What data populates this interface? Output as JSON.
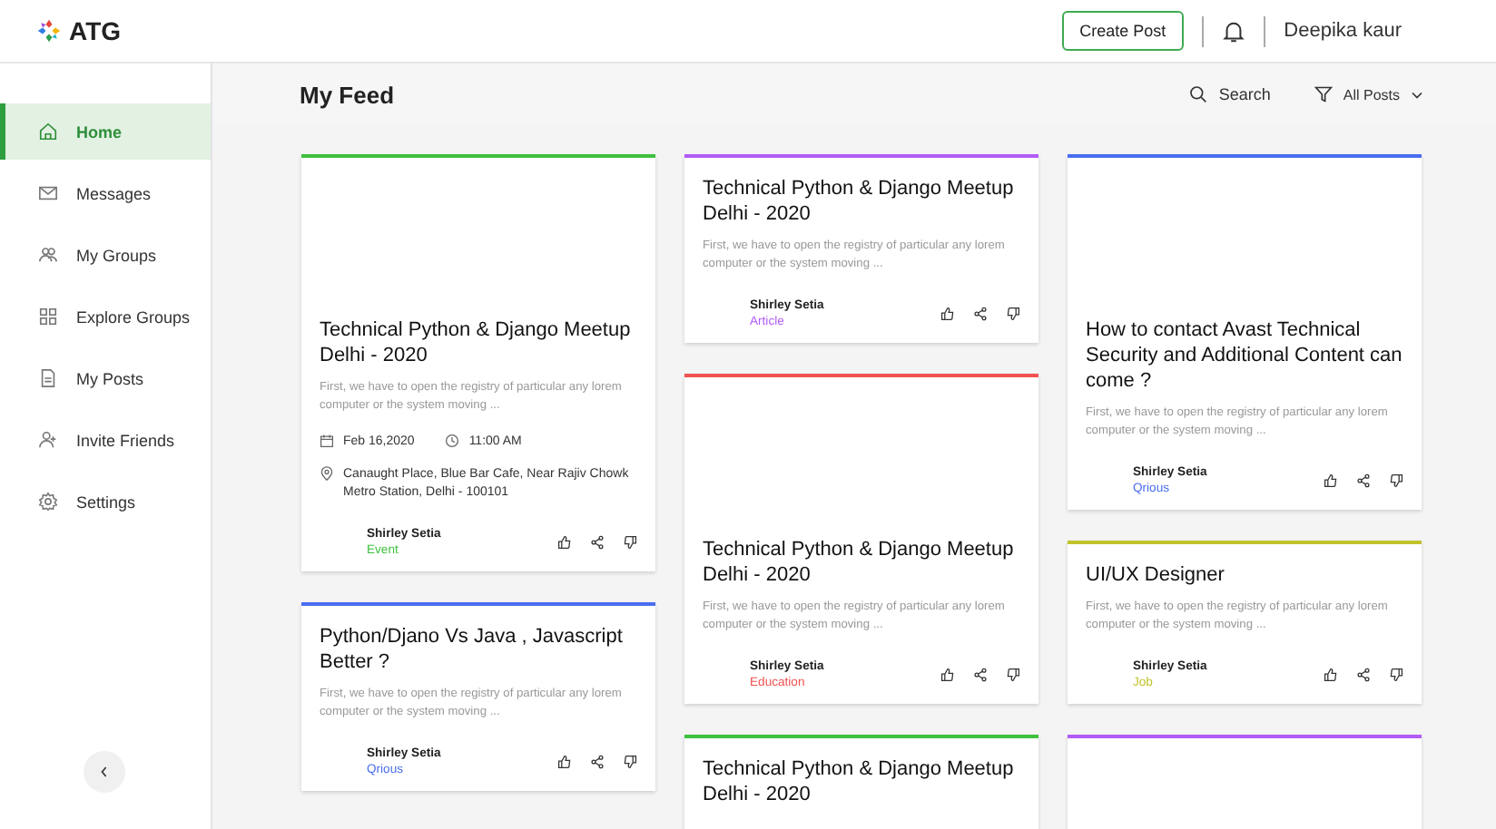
{
  "header": {
    "logo": "ATG",
    "create_button": "Create Post",
    "user_name": "Deepika kaur"
  },
  "sidebar": {
    "items": [
      {
        "label": "Home",
        "selected": true
      },
      {
        "label": "Messages",
        "selected": false
      },
      {
        "label": "My Groups",
        "selected": false
      },
      {
        "label": "Explore Groups",
        "selected": false
      },
      {
        "label": "My Posts",
        "selected": false
      },
      {
        "label": "Invite Friends",
        "selected": false
      },
      {
        "label": "Settings",
        "selected": false
      }
    ]
  },
  "feed": {
    "title": "My Feed",
    "search": "Search",
    "filter": "All Posts"
  },
  "columns": [
    [
      {
        "color": "#3ec13e",
        "cover": true,
        "title": "Technical Python & Django Meetup Delhi - 2020",
        "desc": "First, we have to open the registry of particular any lorem computer or the system moving ...",
        "date": "Feb 16,2020",
        "time": "11:00 AM",
        "location": "Canaught Place, Blue Bar Cafe, Near Rajiv Chowk Metro Station, Delhi - 100101",
        "author": "Shirley Setia",
        "category": "Event"
      },
      {
        "color": "#4a6ef0",
        "cover": false,
        "title": "Python/Djano Vs Java , Javascript Better ?",
        "desc": "First, we have to open the registry of particular any lorem computer or the system moving ...",
        "author": "Shirley Setia",
        "category": "Qrious"
      }
    ],
    [
      {
        "color": "#b15cf6",
        "cover": false,
        "title": "Technical Python & Django Meetup Delhi - 2020",
        "desc": "First, we have to open the registry of particular any lorem computer or the system moving ...",
        "author": "Shirley Setia",
        "category": "Article"
      },
      {
        "color": "#f05252",
        "cover": true,
        "title": "Technical Python & Django Meetup Delhi - 2020",
        "desc": "First, we have to open the registry of particular any lorem computer or the system moving ...",
        "author": "Shirley Setia",
        "category": "Education"
      },
      {
        "color": "#3ec13e",
        "cover": false,
        "title": "Technical Python & Django Meetup Delhi - 2020"
      }
    ],
    [
      {
        "color": "#4a6ef0",
        "cover": true,
        "title": "How to contact Avast Technical Security and Additional Content can come ?",
        "desc": "First, we have to open the registry of particular any lorem computer or the system moving ...",
        "author": "Shirley Setia",
        "category": "Qrious"
      },
      {
        "color": "#c2c22a",
        "cover": false,
        "title": "UI/UX Designer",
        "desc": "First, we have to open the registry of particular any lorem computer or the system moving ...",
        "author": "Shirley Setia",
        "category": "Job"
      },
      {
        "color": "#b15cf6"
      }
    ]
  ]
}
